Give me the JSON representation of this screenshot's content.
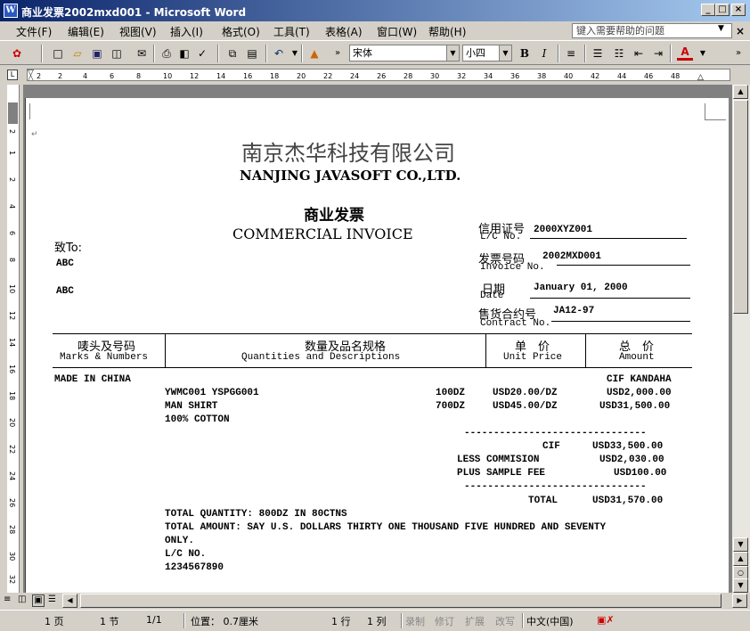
{
  "window": {
    "title": "商业发票2002mxd001 - Microsoft Word",
    "icon": "word-icon",
    "min": "_",
    "max": "□",
    "close": "×"
  },
  "menu": {
    "items": [
      "文件(F)",
      "编辑(E)",
      "视图(V)",
      "插入(I)",
      "格式(O)",
      "工具(T)",
      "表格(A)",
      "窗口(W)",
      "帮助(H)"
    ],
    "help_placeholder": "键入需要帮助的问题"
  },
  "toolbar": {
    "font": "宋体",
    "size": "小四",
    "bold": "B",
    "italic": "I",
    "font_color": "A"
  },
  "ruler": {
    "h_ticks": [
      "2",
      "2",
      "4",
      "6",
      "8",
      "10",
      "12",
      "14",
      "16",
      "18",
      "20",
      "22",
      "24",
      "26",
      "28",
      "30",
      "32",
      "34",
      "36",
      "38",
      "40",
      "42",
      "44",
      "46",
      "48"
    ],
    "v_ticks": [
      "2",
      "1",
      "2",
      "4",
      "6",
      "8",
      "10",
      "12",
      "14",
      "16",
      "18",
      "20",
      "22",
      "24",
      "26",
      "28",
      "30",
      "32"
    ]
  },
  "document": {
    "company_cn": "南京杰华科技有限公司",
    "company_en": "NANJING JAVASOFT CO.,LTD.",
    "title_cn": "商业发票",
    "title_en": "COMMERCIAL INVOICE",
    "to_label": "致To:",
    "to_line1": "ABC",
    "to_line2": "ABC",
    "lc_label_cn": "信用证号",
    "lc_label_en": "L/C No.",
    "lc_value": "2000XYZ001",
    "inv_label_cn": "发票号码",
    "inv_label_en": "Invoice No.",
    "inv_value": "2002MXD001",
    "date_label_cn": "日期",
    "date_label_en": "Date",
    "date_value": "January 01, 2000",
    "contract_label_cn": "售货合约号",
    "contract_label_en": "Contract No.",
    "contract_value": "JA12-97",
    "headers": {
      "marks_cn": "唛头及号码",
      "marks_en": "Marks & Numbers",
      "qty_cn": "数量及品名规格",
      "qty_en": "Quantities and Descriptions",
      "price_cn": "单　价",
      "price_en": "Unit Price",
      "amount_cn": "总　价",
      "amount_en": "Amount"
    },
    "made_in": "MADE IN CHINA",
    "cif_port": "CIF KANDAHA",
    "items": [
      {
        "desc": "YWMC001 YSPGG001",
        "qty": "100DZ",
        "price": "USD20.00/DZ",
        "amount": "USD2,000.00"
      },
      {
        "desc": "MAN SHIRT",
        "qty": "700DZ",
        "price": "USD45.00/DZ",
        "amount": "USD31,500.00"
      }
    ],
    "composition": "100% COTTON",
    "dashes": "-------------------------------",
    "cif_label": "CIF",
    "cif_value": "USD33,500.00",
    "less_label": "LESS COMMISION",
    "less_value": "USD2,030.00",
    "plus_label": "PLUS SAMPLE FEE",
    "plus_value": "USD100.00",
    "total_label": "TOTAL",
    "total_value": "USD31,570.00",
    "total_qty": "TOTAL QUANTITY: 800DZ IN 80CTNS",
    "total_amount_1": "TOTAL AMOUNT: SAY U.S. DOLLARS THIRTY ONE THOUSAND FIVE HUNDRED AND SEVENTY",
    "total_amount_2": "ONLY.",
    "lc_no_label": "L/C NO.",
    "lc_no_value": "1234567890"
  },
  "status": {
    "page": "1 页",
    "section": "1 节",
    "pages": "1/1",
    "position": "位置： 0.7厘米",
    "line": "1 行",
    "col": "1 列",
    "rec": "录制",
    "trk": "修订",
    "ext": "扩展",
    "ovr": "改写",
    "lang": "中文(中国)"
  }
}
